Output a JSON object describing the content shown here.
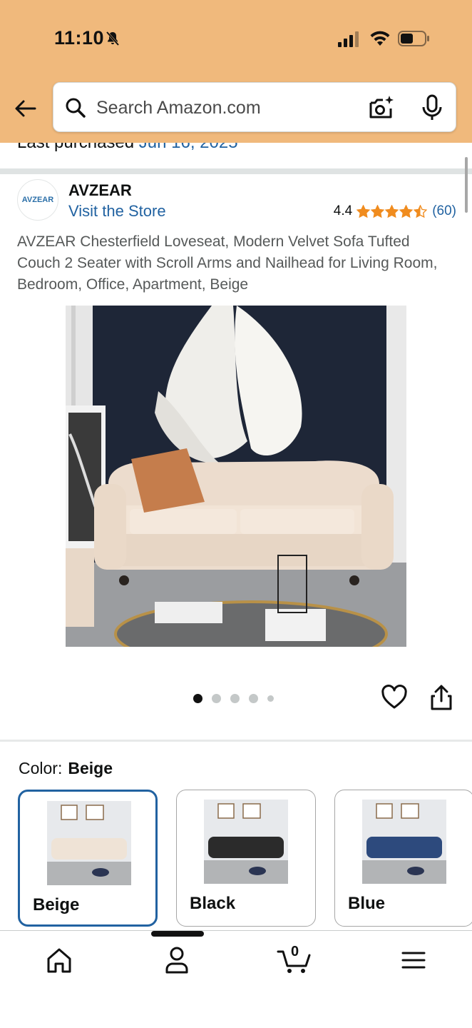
{
  "status_bar": {
    "time": "11:10"
  },
  "search": {
    "placeholder": "Search Amazon.com"
  },
  "last_purchased": {
    "label": "Last purchased",
    "date": "Jun 16, 2025"
  },
  "brand": {
    "logo_text": "AVZEAR",
    "name": "AVZEAR",
    "store_link": "Visit the Store",
    "rating": "4.4",
    "rating_count": "(60)",
    "stars_filled": 4.5
  },
  "product": {
    "title": "AVZEAR Chesterfield Loveseat, Modern Velvet Sofa Tufted Couch 2 Seater with Scroll Arms and Nailhead for Living Room, Bedroom, Office, Apartment, Beige"
  },
  "carousel": {
    "image_count": 5,
    "active_index": 0
  },
  "color": {
    "label": "Color:",
    "selected": "Beige",
    "options": [
      {
        "label": "Beige",
        "sofa_color": "#efe3d6"
      },
      {
        "label": "Black",
        "sofa_color": "#2b2b2b"
      },
      {
        "label": "Blue",
        "sofa_color": "#2d4a7d"
      }
    ]
  },
  "cart": {
    "count": "0"
  },
  "colors": {
    "header": "#f0b97c",
    "link": "#2162a1",
    "star": "#f08c1f"
  }
}
